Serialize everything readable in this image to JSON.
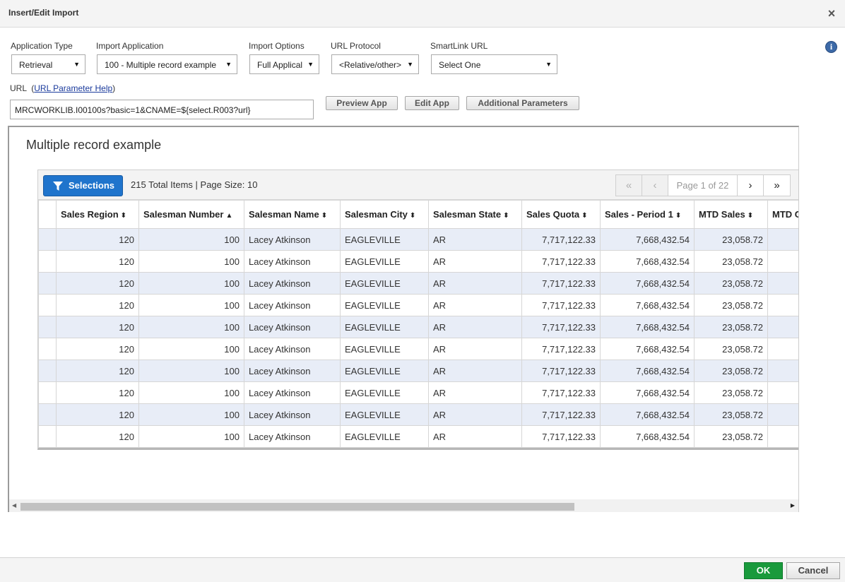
{
  "dialog": {
    "title": "Insert/Edit Import",
    "close_icon": "×"
  },
  "fields": {
    "application_type": {
      "label": "Application Type",
      "value": "Retrieval"
    },
    "import_application": {
      "label": "Import Application",
      "value": "100 - Multiple record example"
    },
    "import_options": {
      "label": "Import Options",
      "value": "Full Applical"
    },
    "url_protocol": {
      "label": "URL Protocol",
      "value": "<Relative/other>"
    },
    "smartlink_url": {
      "label": "SmartLink URL",
      "value": "Select One"
    }
  },
  "url": {
    "label": "URL",
    "help_link": "URL Parameter Help",
    "value": "MRCWORKLIB.I00100s?basic=1&CNAME=${select.R003?url}"
  },
  "buttons": {
    "preview": "Preview App",
    "edit": "Edit App",
    "additional": "Additional Parameters"
  },
  "preview": {
    "title": "Multiple record example",
    "selections_label": "Selections",
    "totals": "215 Total Items | Page Size: 10",
    "page_info": "Page 1 of 22",
    "columns": [
      {
        "label": "",
        "sort": ""
      },
      {
        "label": "Sales Region",
        "sort": "⬍"
      },
      {
        "label": "Salesman Number",
        "sort": "▲"
      },
      {
        "label": "Salesman Name",
        "sort": "⬍"
      },
      {
        "label": "Salesman City",
        "sort": "⬍"
      },
      {
        "label": "Salesman State",
        "sort": "⬍"
      },
      {
        "label": "Sales Quota",
        "sort": "⬍"
      },
      {
        "label": "Sales - Period 1",
        "sort": "⬍"
      },
      {
        "label": "MTD Sales",
        "sort": "⬍"
      },
      {
        "label": "MTD C",
        "sort": ""
      }
    ],
    "rows": [
      [
        "",
        "120",
        "100",
        "Lacey Atkinson",
        "EAGLEVILLE",
        "AR",
        "7,717,122.33",
        "7,668,432.54",
        "23,058.72",
        ""
      ],
      [
        "",
        "120",
        "100",
        "Lacey Atkinson",
        "EAGLEVILLE",
        "AR",
        "7,717,122.33",
        "7,668,432.54",
        "23,058.72",
        ""
      ],
      [
        "",
        "120",
        "100",
        "Lacey Atkinson",
        "EAGLEVILLE",
        "AR",
        "7,717,122.33",
        "7,668,432.54",
        "23,058.72",
        ""
      ],
      [
        "",
        "120",
        "100",
        "Lacey Atkinson",
        "EAGLEVILLE",
        "AR",
        "7,717,122.33",
        "7,668,432.54",
        "23,058.72",
        ""
      ],
      [
        "",
        "120",
        "100",
        "Lacey Atkinson",
        "EAGLEVILLE",
        "AR",
        "7,717,122.33",
        "7,668,432.54",
        "23,058.72",
        ""
      ],
      [
        "",
        "120",
        "100",
        "Lacey Atkinson",
        "EAGLEVILLE",
        "AR",
        "7,717,122.33",
        "7,668,432.54",
        "23,058.72",
        ""
      ],
      [
        "",
        "120",
        "100",
        "Lacey Atkinson",
        "EAGLEVILLE",
        "AR",
        "7,717,122.33",
        "7,668,432.54",
        "23,058.72",
        ""
      ],
      [
        "",
        "120",
        "100",
        "Lacey Atkinson",
        "EAGLEVILLE",
        "AR",
        "7,717,122.33",
        "7,668,432.54",
        "23,058.72",
        ""
      ],
      [
        "",
        "120",
        "100",
        "Lacey Atkinson",
        "EAGLEVILLE",
        "AR",
        "7,717,122.33",
        "7,668,432.54",
        "23,058.72",
        ""
      ],
      [
        "",
        "120",
        "100",
        "Lacey Atkinson",
        "EAGLEVILLE",
        "AR",
        "7,717,122.33",
        "7,668,432.54",
        "23,058.72",
        ""
      ]
    ]
  },
  "footer": {
    "ok": "OK",
    "cancel": "Cancel"
  },
  "colors": {
    "ok_green": "#199a3c",
    "selections_blue": "#1f74cc",
    "row_alt": "#e8edf7"
  }
}
